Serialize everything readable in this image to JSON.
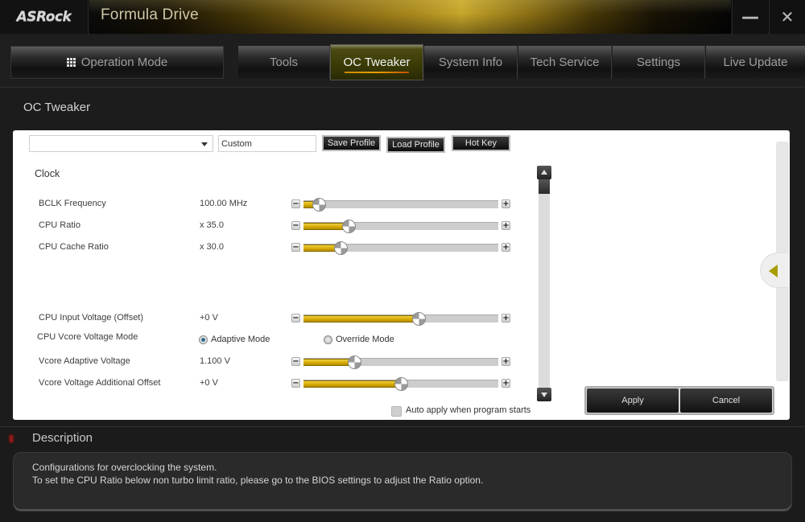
{
  "titlebar": {
    "logo": "ASRock",
    "app_title": "Formula Drive",
    "minimize_label": "—",
    "close_label": "✕"
  },
  "nav": {
    "operation_mode": "Operation Mode",
    "tabs": [
      {
        "label": "Tools",
        "active": false
      },
      {
        "label": "OC Tweaker",
        "active": true
      },
      {
        "label": "System Info",
        "active": false
      },
      {
        "label": "Tech Service",
        "active": false
      },
      {
        "label": "Settings",
        "active": false
      },
      {
        "label": "Live Update",
        "active": false
      }
    ]
  },
  "page": {
    "title": "OC Tweaker"
  },
  "profile": {
    "selected": "",
    "name_value": "Custom",
    "save_label": "Save Profile",
    "load_label": "Load Profile",
    "hotkey_label": "Hot Key"
  },
  "clock": {
    "section_label": "Clock",
    "rows": [
      {
        "label": "BCLK Frequency",
        "value": "100.00 MHz",
        "slider_fraction": 0.08
      },
      {
        "label": "CPU Ratio",
        "value": "x 35.0",
        "slider_fraction": 0.23
      },
      {
        "label": "CPU Cache Ratio",
        "value": "x 30.0",
        "slider_fraction": 0.19
      }
    ]
  },
  "voltage": {
    "input_voltage": {
      "label": "CPU Input Voltage (Offset)",
      "value": "+0 V",
      "slider_fraction": 0.59
    },
    "vcore_mode": {
      "label": "CPU Vcore Voltage Mode",
      "options": [
        {
          "label": "Adaptive Mode",
          "selected": true
        },
        {
          "label": "Override Mode",
          "selected": false
        }
      ]
    },
    "vcore_adaptive": {
      "label": "Vcore Adaptive Voltage",
      "value": "1.100 V",
      "slider_fraction": 0.26
    },
    "vcore_offset": {
      "label": "Vcore Voltage Additional Offset",
      "value": "+0 V",
      "slider_fraction": 0.5
    }
  },
  "slider_signs": {
    "minus": "−",
    "plus": "+"
  },
  "auto_apply": {
    "label": "Auto apply when program starts",
    "checked": false
  },
  "actions": {
    "apply_label": "Apply",
    "cancel_label": "Cancel"
  },
  "description": {
    "title": "Description",
    "lines": [
      "Configurations for overclocking the system.",
      "To set the CPU Ratio below non turbo limit ratio, please go to the BIOS settings to adjust the Ratio option."
    ]
  },
  "colors": {
    "accent_gold": "#d4a800",
    "active_tab_underline": "#e8a000"
  }
}
